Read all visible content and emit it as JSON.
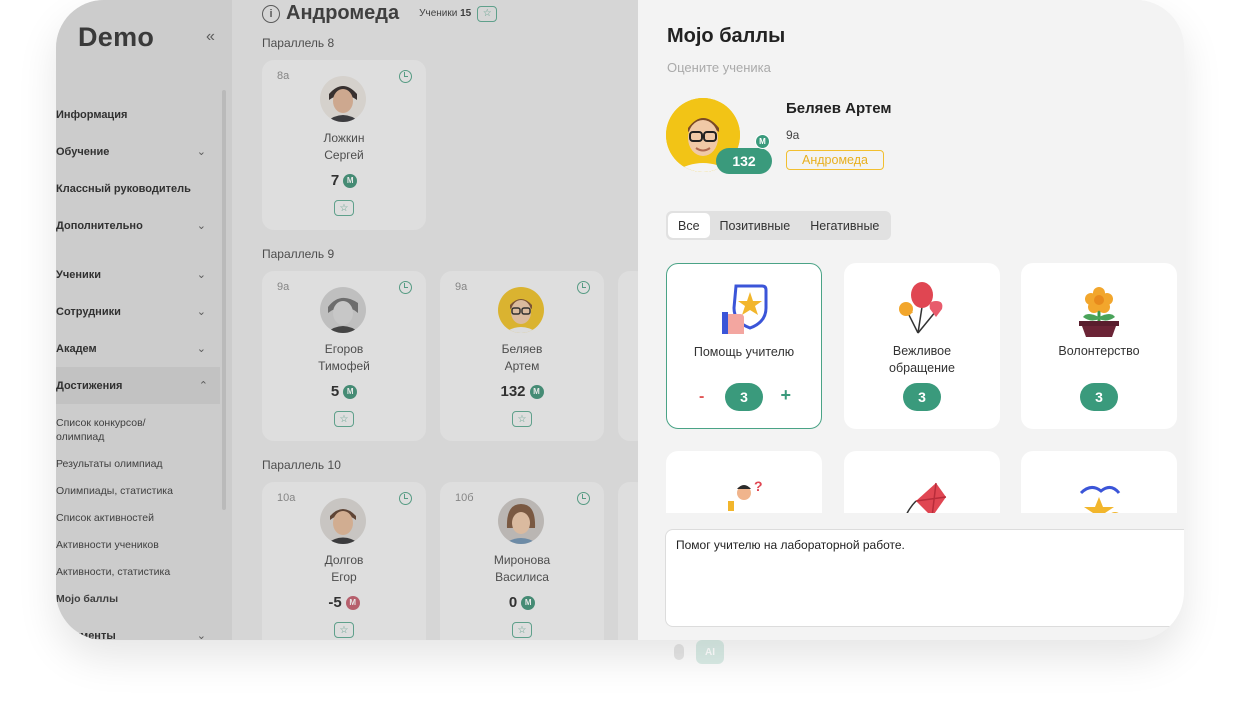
{
  "sidebar": {
    "brand": "Demo",
    "collapse_icon": "«",
    "menu": [
      {
        "label": "Информация",
        "chev": ""
      },
      {
        "label": "Обучение",
        "chev": "⌄"
      },
      {
        "label": "Классный руководитель",
        "chev": ""
      },
      {
        "label": "Дополнительно",
        "chev": "⌄"
      },
      {
        "label": "Ученики",
        "chev": "⌄"
      },
      {
        "label": "Сотрудники",
        "chev": "⌄"
      },
      {
        "label": "Академ",
        "chev": "⌄"
      },
      {
        "label": "Достижения",
        "chev": "⌃"
      }
    ],
    "submenu": [
      "Список конкурсов/ олимпиад",
      "Результаты олимпиад",
      "Олимпиады, статистика",
      "Список активностей",
      "Активности учеников",
      "Активности, статистика",
      "Mojo баллы"
    ],
    "last_item": {
      "label": "струменты",
      "chev": "⌄"
    }
  },
  "main": {
    "title": "Андромеда",
    "students_label": "Ученики",
    "students_count": "15",
    "parallels": [
      "Параллель 8",
      "Параллель 9",
      "Параллель 10"
    ],
    "students": [
      {
        "cls": "8а",
        "name1": "Ложкин",
        "name2": "Сергей",
        "points": "7",
        "badge": "M"
      },
      {
        "cls": "9а",
        "name1": "Егоров",
        "name2": "Тимофей",
        "points": "5",
        "badge": "M"
      },
      {
        "cls": "9а",
        "name1": "Беляев",
        "name2": "Артем",
        "points": "132",
        "badge": "M"
      },
      {
        "cls": "10а",
        "name1": "Долгов",
        "name2": "Егор",
        "points": "-5",
        "badge": "M"
      },
      {
        "cls": "10б",
        "name1": "Миронова",
        "name2": "Василиса",
        "points": "0",
        "badge": "M"
      }
    ]
  },
  "panel": {
    "title": "Mojo баллы",
    "subtitle": "Оцените ученика",
    "student": {
      "name": "Беляев Артем",
      "cls": "9а",
      "group": "Андромеда",
      "points": "132",
      "badge": "M"
    },
    "tabs": [
      "Все",
      "Позитивные",
      "Негативные"
    ],
    "achievements": [
      {
        "label": "Помощь учителю",
        "count": "3",
        "icon": "teacher-help-icon"
      },
      {
        "label": "Вежливое обращение",
        "count": "3",
        "icon": "balloons-icon"
      },
      {
        "label": "Волонтерство",
        "count": "3",
        "icon": "flower-pot-icon"
      }
    ],
    "stepper": {
      "minus": "-",
      "plus": "+"
    },
    "comment": "Помог учителю на лабораторной работе.",
    "ai_label": "AI"
  },
  "colors": {
    "accent": "#3a9a7c",
    "tag": "#f2bf2f",
    "negative": "#e05454"
  }
}
